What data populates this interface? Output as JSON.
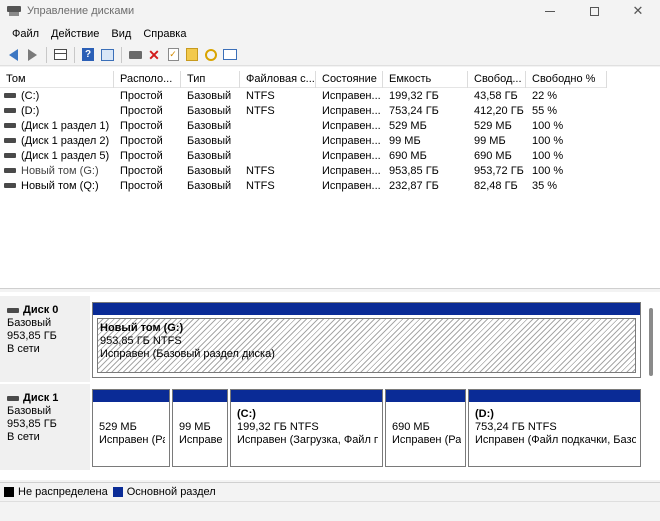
{
  "window": {
    "title": "Управление дисками",
    "icon": "disk-management-icon",
    "controls": [
      "minimize-icon",
      "maximize-icon",
      "close-icon"
    ]
  },
  "menu": [
    "Файл",
    "Действие",
    "Вид",
    "Справка"
  ],
  "toolbar": {
    "icons": [
      "back-arrow-icon",
      "forward-arrow-icon",
      "show-hide-tree-icon",
      "help-icon",
      "console-view-icon",
      "connect-disk-icon",
      "delete-icon",
      "check-icon",
      "up-folder-icon",
      "find-icon",
      "properties-icon"
    ],
    "close_glyph": "✕",
    "help_glyph": "?",
    "check_glyph": "✓"
  },
  "volume_table": {
    "columns": [
      "Том",
      "Располо...",
      "Тип",
      "Файловая с...",
      "Состояние",
      "Емкость",
      "Свобод...",
      "Свободно %"
    ],
    "rows": [
      {
        "name": "(C:)",
        "layout": "Простой",
        "type": "Базовый",
        "fs": "NTFS",
        "status": "Исправен...",
        "capacity": "199,32 ГБ",
        "free": "43,58 ГБ",
        "free_pct": "22 %"
      },
      {
        "name": "(D:)",
        "layout": "Простой",
        "type": "Базовый",
        "fs": "NTFS",
        "status": "Исправен...",
        "capacity": "753,24 ГБ",
        "free": "412,20 ГБ",
        "free_pct": "55 %"
      },
      {
        "name": "(Диск 1 раздел 1)",
        "layout": "Простой",
        "type": "Базовый",
        "fs": "",
        "status": "Исправен...",
        "capacity": "529 МБ",
        "free": "529 МБ",
        "free_pct": "100 %"
      },
      {
        "name": "(Диск 1 раздел 2)",
        "layout": "Простой",
        "type": "Базовый",
        "fs": "",
        "status": "Исправен...",
        "capacity": "99 МБ",
        "free": "99 МБ",
        "free_pct": "100 %"
      },
      {
        "name": "(Диск 1 раздел 5)",
        "layout": "Простой",
        "type": "Базовый",
        "fs": "",
        "status": "Исправен...",
        "capacity": "690 МБ",
        "free": "690 МБ",
        "free_pct": "100 %"
      },
      {
        "name": "Новый том (G:)",
        "layout": "Простой",
        "type": "Базовый",
        "fs": "NTFS",
        "status": "Исправен...",
        "capacity": "953,85 ГБ",
        "free": "953,72 ГБ",
        "free_pct": "100 %"
      },
      {
        "name": "Новый том (Q:)",
        "layout": "Простой",
        "type": "Базовый",
        "fs": "NTFS",
        "status": "Исправен...",
        "capacity": "232,87 ГБ",
        "free": "82,48 ГБ",
        "free_pct": "35 %"
      }
    ]
  },
  "disks": [
    {
      "label": "Диск 0",
      "kind": "Базовый",
      "size": "953,85 ГБ",
      "state": "В сети",
      "partitions": [
        {
          "title": "Новый том  (G:)",
          "line1": "953,85 ГБ NTFS",
          "line2": "Исправен (Базовый раздел диска)",
          "selected": true
        }
      ]
    },
    {
      "label": "Диск 1",
      "kind": "Базовый",
      "size": "953,85 ГБ",
      "state": "В сети",
      "partitions": [
        {
          "title": "",
          "line1": "529 МБ",
          "line2": "Исправен (Ра"
        },
        {
          "title": "",
          "line1": "99 МБ",
          "line2": "Исправен"
        },
        {
          "title": "(C:)",
          "line1": "199,32 ГБ NTFS",
          "line2": "Исправен (Загрузка, Файл по"
        },
        {
          "title": "",
          "line1": "690 МБ",
          "line2": "Исправен (Раз"
        },
        {
          "title": "(D:)",
          "line1": "753,24 ГБ NTFS",
          "line2": "Исправен (Файл подкачки, Базов"
        }
      ]
    }
  ],
  "legend": [
    {
      "label": "Не распределена",
      "color": "#000000"
    },
    {
      "label": "Основной раздел",
      "color": "#0a2b96"
    }
  ],
  "colors": {
    "partition_header": "#0a2b96",
    "unallocated": "#000000"
  }
}
